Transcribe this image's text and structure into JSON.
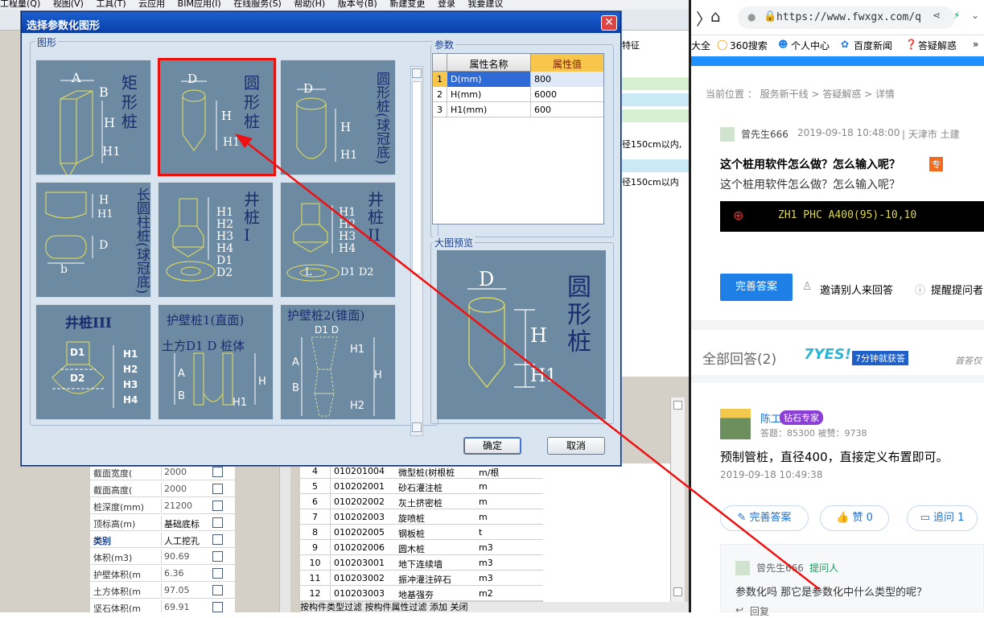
{
  "app": {
    "menu": [
      "工程量(Q)",
      "视图(V)",
      "工具(T)",
      "云应用",
      "BIM应用(I)",
      "在线服务(S)",
      "帮助(H)",
      "版本号(B)",
      "新建变更",
      "登录",
      "我要建议"
    ],
    "right_pane_rows": [
      "特征",
      "",
      "",
      "",
      "",
      "",
      "",
      "径150cm以内,",
      "",
      "",
      "径150cm以内"
    ],
    "props": [
      {
        "name": "截面宽度(",
        "value": "2000"
      },
      {
        "name": "截面高度(",
        "value": "2000"
      },
      {
        "name": "桩深度(mm)",
        "value": "21200"
      },
      {
        "name": "顶标高(m)",
        "value": "基础底标"
      },
      {
        "name": "类别",
        "value": "人工挖孔"
      },
      {
        "name": "体积(m3)",
        "value": "90.69"
      },
      {
        "name": "护壁体积(m",
        "value": "6.36"
      },
      {
        "name": "土方体积(m",
        "value": "97.05"
      },
      {
        "name": "坚石体积(m",
        "value": "69.91"
      }
    ],
    "list": [
      {
        "no": "4",
        "code": "010201004",
        "name": "微型桩(树根桩)",
        "unit": "m/根"
      },
      {
        "no": "5",
        "code": "010202001",
        "name": "砂石灌注桩",
        "unit": "m"
      },
      {
        "no": "6",
        "code": "010202002",
        "name": "灰土挤密桩",
        "unit": "m"
      },
      {
        "no": "7",
        "code": "010202003",
        "name": "旋喷桩",
        "unit": "m"
      },
      {
        "no": "8",
        "code": "010202005",
        "name": "钢板桩",
        "unit": "t"
      },
      {
        "no": "9",
        "code": "010202006",
        "name": "圆木桩",
        "unit": "m3"
      },
      {
        "no": "10",
        "code": "010203001",
        "name": "地下连续墙",
        "unit": "m3"
      },
      {
        "no": "11",
        "code": "010203002",
        "name": "振冲灌注碎石",
        "unit": "m3"
      },
      {
        "no": "12",
        "code": "010203003",
        "name": "地基强夯",
        "unit": "m2"
      }
    ],
    "bottom_bar": "按构件类型过滤   按构件属性过滤   添加  关闭"
  },
  "dialog": {
    "title": "选择参数化图形",
    "close": "✕",
    "figure_group": "图形",
    "param_group": "参数",
    "preview_group": "大图预览",
    "tiles": [
      {
        "label": "矩形桩",
        "sel": false
      },
      {
        "label": "圆形桩",
        "sel": true
      },
      {
        "label": "圆形桩(球冠底)",
        "sel": false
      },
      {
        "label": "长圆柱桩(球冠底)",
        "sel": false
      },
      {
        "label": "井桩I",
        "sel": false
      },
      {
        "label": "井桩II",
        "sel": false
      },
      {
        "label": "井桩III",
        "sel": false
      },
      {
        "label": "护壁桩1(直面)",
        "sel": false
      },
      {
        "label": "护壁桩2(锥面)",
        "sel": false
      }
    ],
    "param_headers": [
      "属性名称",
      "属性值"
    ],
    "params": [
      {
        "no": "1",
        "name": "D(mm)",
        "value": "800"
      },
      {
        "no": "2",
        "name": "H(mm)",
        "value": "6000"
      },
      {
        "no": "3",
        "name": "H1(mm)",
        "value": "600"
      }
    ],
    "preview_label": "圆形桩",
    "ok": "确定",
    "cancel": "取消"
  },
  "browser": {
    "url": "https://www.fwxgx.com/q",
    "bookmarks": [
      "大全",
      "360搜索",
      "个人中心",
      "百度新闻",
      "答疑解惑"
    ],
    "breadcrumb": "当前位置 ： 服务新干线 > 答疑解惑 > 详情",
    "asker": "曾先生666",
    "ask_time": "2019-09-18 10:48:00",
    "ask_loc": "|   天津市 土建",
    "question_title": "这个桩用软件怎么做？怎么输入呢？",
    "question_tag": "专",
    "question_body": "这个桩用软件怎么做？怎么输入呢？",
    "cad_text": "ZH1   PHC A400(95)-10,10",
    "complete_btn": "完善答案",
    "invite": "邀请别人来回答",
    "remind": "提醒提问者",
    "all_answers": "全部回答(2)",
    "yes_badge": "7YES!",
    "yes_sub": "7分钟就获答",
    "first_answer": "首答仅",
    "answerer": "陈工",
    "expert_tag": "钻石专家",
    "answer_stats": "答题：85300   被赞：9738",
    "answer_text": "预制管桩，直径400，直接定义布置即可。",
    "answer_time": "2019-09-18 10:49:38",
    "btn_complete": "完善答案",
    "btn_like": "赞 0",
    "btn_ask": "追问  1",
    "followup_user": "曾先生666",
    "followup_tag": "提问人",
    "followup_text": "参数化吗 那它是参数化中什么类型的呢？",
    "reply": "回复"
  }
}
